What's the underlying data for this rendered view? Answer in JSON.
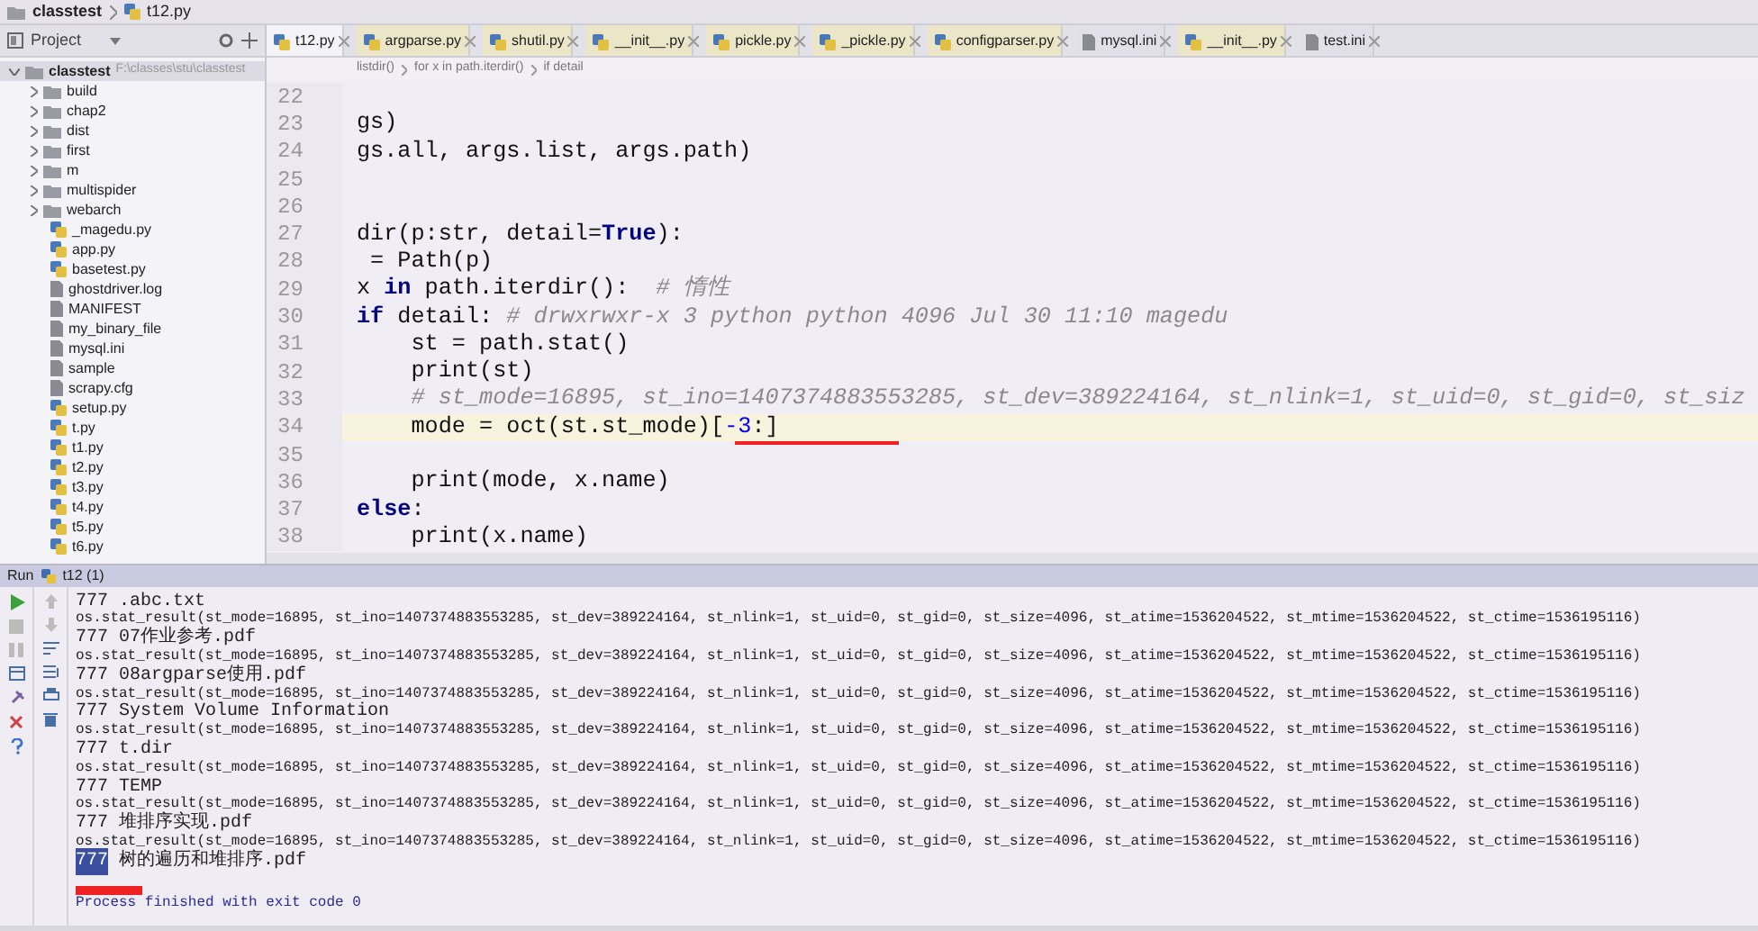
{
  "navbar": {
    "breadcrumbs": [
      "classtest",
      "t12.py"
    ]
  },
  "project_panel": {
    "title": "Project",
    "root": {
      "name": "classtest",
      "path": "F:\\classes\\stu\\classtest",
      "expanded": true,
      "children": [
        {
          "name": "build",
          "kind": "folder"
        },
        {
          "name": "chap2",
          "kind": "folder"
        },
        {
          "name": "dist",
          "kind": "folder"
        },
        {
          "name": "first",
          "kind": "folder"
        },
        {
          "name": "m",
          "kind": "folder"
        },
        {
          "name": "multispider",
          "kind": "folder"
        },
        {
          "name": "webarch",
          "kind": "folder"
        },
        {
          "name": "_magedu.py",
          "kind": "python"
        },
        {
          "name": "app.py",
          "kind": "python"
        },
        {
          "name": "basetest.py",
          "kind": "python"
        },
        {
          "name": "ghostdriver.log",
          "kind": "file"
        },
        {
          "name": "MANIFEST",
          "kind": "file"
        },
        {
          "name": "my_binary_file",
          "kind": "file"
        },
        {
          "name": "mysql.ini",
          "kind": "file"
        },
        {
          "name": "sample",
          "kind": "file"
        },
        {
          "name": "scrapy.cfg",
          "kind": "file"
        },
        {
          "name": "setup.py",
          "kind": "python"
        },
        {
          "name": "t.py",
          "kind": "python"
        },
        {
          "name": "t1.py",
          "kind": "python"
        },
        {
          "name": "t2.py",
          "kind": "python"
        },
        {
          "name": "t3.py",
          "kind": "python"
        },
        {
          "name": "t4.py",
          "kind": "python"
        },
        {
          "name": "t5.py",
          "kind": "python"
        },
        {
          "name": "t6.py",
          "kind": "python"
        }
      ]
    }
  },
  "tabs": [
    {
      "label": "t12.py",
      "kind": "python",
      "selected": true
    },
    {
      "label": "argparse.py",
      "kind": "python",
      "selected": false
    },
    {
      "label": "shutil.py",
      "kind": "python",
      "selected": false
    },
    {
      "label": "__init__.py",
      "kind": "python",
      "selected": false
    },
    {
      "label": "pickle.py",
      "kind": "python",
      "selected": false
    },
    {
      "label": "_pickle.py",
      "kind": "python",
      "selected": false
    },
    {
      "label": "configparser.py",
      "kind": "python",
      "selected": false
    },
    {
      "label": "mysql.ini",
      "kind": "file",
      "selected": false
    },
    {
      "label": "__init__.py",
      "kind": "python",
      "selected": false
    },
    {
      "label": "test.ini",
      "kind": "file",
      "selected": false
    }
  ],
  "editor": {
    "breadcrumbs": [
      "listdir()",
      "for x in path.iterdir()",
      "if detail"
    ],
    "lines": [
      {
        "number": "22",
        "current": false
      },
      {
        "number": "23",
        "current": false,
        "parts": [
          {
            "text": "gs)",
            "kind": "code"
          }
        ]
      },
      {
        "number": "24",
        "current": false,
        "parts": [
          {
            "text": "gs.all, args.list, args.path)",
            "kind": "code"
          }
        ]
      },
      {
        "number": "25",
        "current": false
      },
      {
        "number": "26",
        "current": false
      },
      {
        "number": "27",
        "current": false,
        "parts": [
          {
            "text": "dir(p:str, detail=",
            "kind": "code"
          },
          {
            "text": "True",
            "kind": "keyword"
          },
          {
            "text": "):",
            "kind": "code"
          }
        ]
      },
      {
        "number": "28",
        "current": false,
        "parts": [
          {
            "text": " = Path(p)",
            "kind": "code"
          }
        ]
      },
      {
        "number": "29",
        "current": false,
        "parts": [
          {
            "text": "x ",
            "kind": "code"
          },
          {
            "text": "in",
            "kind": "keyword"
          },
          {
            "text": " path.iterdir():  ",
            "kind": "code"
          },
          {
            "text": "# 惰性",
            "kind": "comment"
          }
        ]
      },
      {
        "number": "30",
        "current": false,
        "parts": [
          {
            "text": "if",
            "kind": "keyword"
          },
          {
            "text": " detail: ",
            "kind": "code"
          },
          {
            "text": "# drwxrwxr-x 3 python python 4096 Jul 30 11:10 magedu",
            "kind": "comment"
          }
        ]
      },
      {
        "number": "31",
        "current": false,
        "parts": [
          {
            "text": "    st = path.stat()",
            "kind": "code"
          }
        ]
      },
      {
        "number": "32",
        "current": false,
        "parts": [
          {
            "text": "    print(st)",
            "kind": "code"
          }
        ]
      },
      {
        "number": "33",
        "current": false,
        "parts": [
          {
            "text": "    # st_mode=16895, st_ino=1407374883553285, st_dev=389224164, st_nlink=1, st_uid=0, st_gid=0, st_siz",
            "kind": "comment"
          }
        ]
      },
      {
        "number": "34",
        "current": true,
        "parts": [
          {
            "text": "    mode = oct(st.st_mode)[",
            "kind": "code"
          },
          {
            "text": "-3",
            "kind": "number"
          },
          {
            "text": ":]",
            "kind": "code"
          }
        ]
      },
      {
        "number": "35",
        "current": false
      },
      {
        "number": "36",
        "current": false,
        "parts": [
          {
            "text": "    print(mode, x.name)",
            "kind": "code"
          }
        ]
      },
      {
        "number": "37",
        "current": false,
        "parts": [
          {
            "text": "else",
            "kind": "keyword"
          },
          {
            "text": ":",
            "kind": "code"
          }
        ]
      },
      {
        "number": "38",
        "current": false,
        "parts": [
          {
            "text": "    print(x.name)",
            "kind": "code"
          }
        ]
      }
    ]
  },
  "run_panel": {
    "title": "Run",
    "config": "t12 (1)",
    "output": [
      {
        "kind": "name",
        "text": "777 .abc.txt"
      },
      {
        "kind": "stat",
        "text": "os.stat_result(st_mode=16895, st_ino=1407374883553285, st_dev=389224164, st_nlink=1, st_uid=0, st_gid=0, st_size=4096, st_atime=1536204522, st_mtime=1536204522, st_ctime=1536195116)"
      },
      {
        "kind": "name",
        "text": "777 07作业参考.pdf"
      },
      {
        "kind": "stat",
        "text": "os.stat_result(st_mode=16895, st_ino=1407374883553285, st_dev=389224164, st_nlink=1, st_uid=0, st_gid=0, st_size=4096, st_atime=1536204522, st_mtime=1536204522, st_ctime=1536195116)"
      },
      {
        "kind": "name",
        "text": "777 08argparse使用.pdf"
      },
      {
        "kind": "stat",
        "text": "os.stat_result(st_mode=16895, st_ino=1407374883553285, st_dev=389224164, st_nlink=1, st_uid=0, st_gid=0, st_size=4096, st_atime=1536204522, st_mtime=1536204522, st_ctime=1536195116)"
      },
      {
        "kind": "name",
        "text": "777 System Volume Information"
      },
      {
        "kind": "stat",
        "text": "os.stat_result(st_mode=16895, st_ino=1407374883553285, st_dev=389224164, st_nlink=1, st_uid=0, st_gid=0, st_size=4096, st_atime=1536204522, st_mtime=1536204522, st_ctime=1536195116)"
      },
      {
        "kind": "name",
        "text": "777 t.dir"
      },
      {
        "kind": "stat",
        "text": "os.stat_result(st_mode=16895, st_ino=1407374883553285, st_dev=389224164, st_nlink=1, st_uid=0, st_gid=0, st_size=4096, st_atime=1536204522, st_mtime=1536204522, st_ctime=1536195116)"
      },
      {
        "kind": "name",
        "text": "777 TEMP"
      },
      {
        "kind": "stat",
        "text": "os.stat_result(st_mode=16895, st_ino=1407374883553285, st_dev=389224164, st_nlink=1, st_uid=0, st_gid=0, st_size=4096, st_atime=1536204522, st_mtime=1536204522, st_ctime=1536195116)"
      },
      {
        "kind": "name",
        "text": "777 堆排序实现.pdf"
      },
      {
        "kind": "stat",
        "text": "os.stat_result(st_mode=16895, st_ino=1407374883553285, st_dev=389224164, st_nlink=1, st_uid=0, st_gid=0, st_size=4096, st_atime=1536204522, st_mtime=1536204522, st_ctime=1536195116)"
      },
      {
        "kind": "selection",
        "selected": "777",
        "text": " 树的遍历和堆排序.pdf"
      },
      {
        "kind": "blank"
      },
      {
        "kind": "exit",
        "text": "Process finished with exit code 0"
      }
    ]
  }
}
